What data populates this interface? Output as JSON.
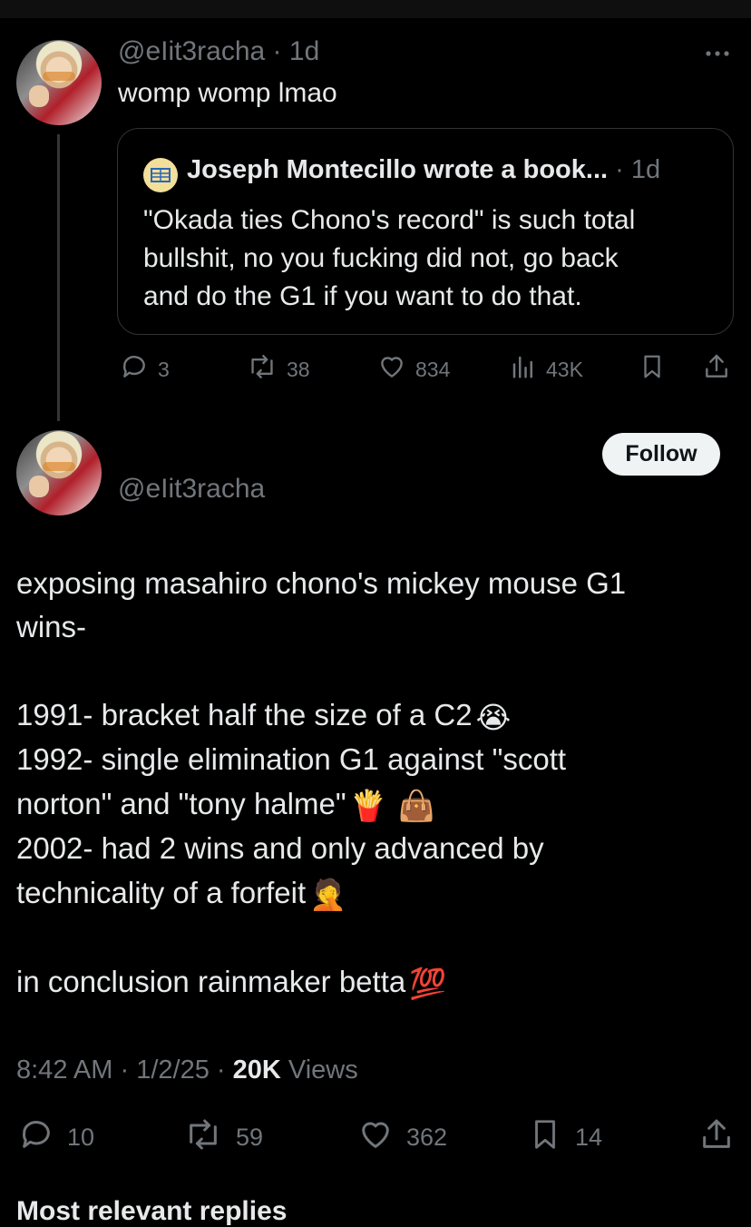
{
  "reply_tweet": {
    "handle": "@eIit3racha",
    "separator": "·",
    "time": "1d",
    "text": "womp womp lmao",
    "more_icon": "more-icon",
    "quote": {
      "author": "Joseph Montecillo wrote a book...",
      "separator": "·",
      "time": "1d",
      "badge_icon": "wrestling-ring-icon",
      "lines": [
        "\"Okada ties Chono's record\" is such total",
        "bullshit, no you fucking did not, go back",
        "and do the G1 if you want to do that."
      ]
    },
    "actions": {
      "replies": "3",
      "reposts": "38",
      "likes": "834",
      "views": "43K"
    }
  },
  "main_tweet": {
    "handle": "@eIit3racha",
    "follow_label": "Follow",
    "lines": [
      "exposing masahiro chono's mickey mouse G1",
      "wins-",
      "1991- bracket half the size of a C2",
      "1992- single elimination G1 against \"scott",
      "norton\" and \"tony halme\"",
      "2002- had 2 wins and only advanced by",
      "technicality of a forfeit",
      "in conclusion rainmaker betta"
    ],
    "emojis": {
      "crying": "😭",
      "fries": "🍟",
      "handbag": "👜",
      "facepalm": "🤦",
      "hundred": "💯"
    },
    "meta": {
      "time": "8:42 AM",
      "sep1": "·",
      "date": "1/2/25",
      "sep2": "·",
      "views_count": "20K",
      "views_label": "Views"
    },
    "actions": {
      "replies": "10",
      "reposts": "59",
      "likes": "362",
      "bookmarks": "14"
    }
  },
  "replies_header": "Most relevant replies"
}
